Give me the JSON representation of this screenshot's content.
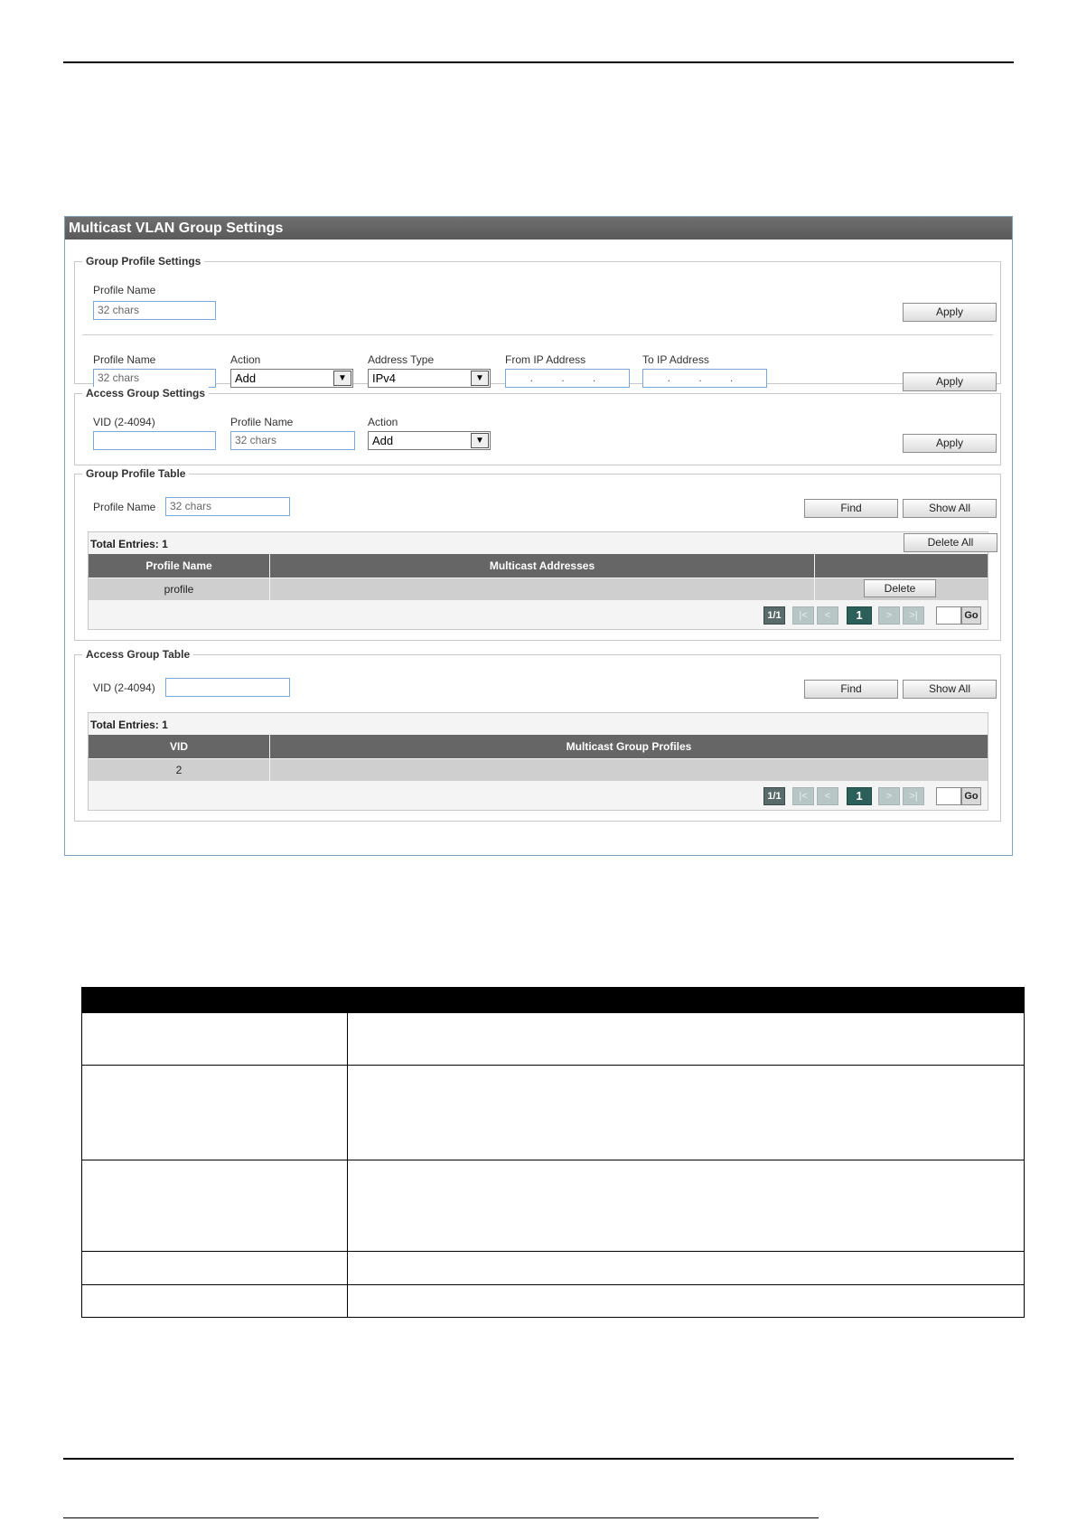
{
  "panel": {
    "title": "Multicast VLAN Group Settings",
    "group_profile_settings": {
      "legend": "Group Profile Settings",
      "profile_name_label": "Profile Name",
      "profile_name_placeholder": "32 chars",
      "apply": "Apply",
      "row2": {
        "profile_name_label": "Profile Name",
        "profile_name_placeholder": "32 chars",
        "action_label": "Action",
        "action_value": "Add",
        "address_type_label": "Address Type",
        "address_type_value": "IPv4",
        "from_ip_label": "From IP Address",
        "from_ip_value": ". . .",
        "to_ip_label": "To IP Address",
        "to_ip_value": ". . .",
        "apply": "Apply"
      }
    },
    "access_group_settings": {
      "legend": "Access Group Settings",
      "vid_label": "VID (2-4094)",
      "profile_name_label": "Profile Name",
      "profile_name_placeholder": "32 chars",
      "action_label": "Action",
      "action_value": "Add",
      "apply": "Apply"
    },
    "group_profile_table": {
      "legend": "Group Profile Table",
      "profile_name_label": "Profile Name",
      "profile_name_placeholder": "32 chars",
      "find": "Find",
      "show_all": "Show All",
      "total_entries": "Total Entries: 1",
      "delete_all": "Delete All",
      "columns": [
        "Profile Name",
        "Multicast Addresses",
        ""
      ],
      "rows": [
        {
          "profile_name": "profile",
          "multicast_addresses": "",
          "action": "Delete"
        }
      ],
      "pagination": {
        "page_indicator": "1/1",
        "first": "|<",
        "prev": "<",
        "current": "1",
        "next": ">",
        "last": ">|",
        "go": "Go"
      }
    },
    "access_group_table": {
      "legend": "Access Group Table",
      "vid_label": "VID (2-4094)",
      "find": "Find",
      "show_all": "Show All",
      "total_entries": "Total Entries: 1",
      "columns": [
        "VID",
        "Multicast Group Profiles"
      ],
      "rows": [
        {
          "vid": "2",
          "profiles": ""
        }
      ],
      "pagination": {
        "page_indicator": "1/1",
        "first": "|<",
        "prev": "<",
        "current": "1",
        "next": ">",
        "last": ">|",
        "go": "Go"
      }
    }
  }
}
